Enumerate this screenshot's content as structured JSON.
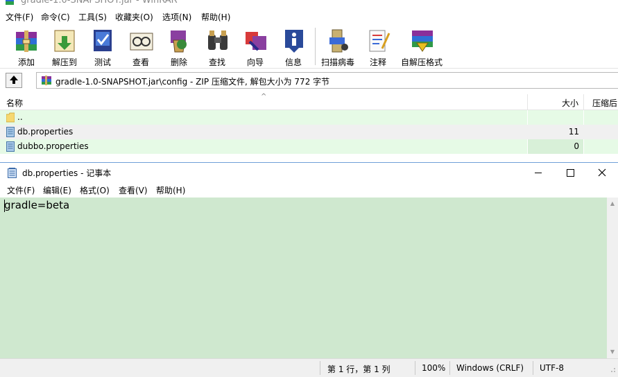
{
  "winrar": {
    "title": "gradle-1.0-SNAPSHOT.jar - WinRAR",
    "menu": [
      "文件(F)",
      "命令(C)",
      "工具(S)",
      "收藏夹(O)",
      "选项(N)",
      "帮助(H)"
    ],
    "toolbar": [
      {
        "label": "添加",
        "icon": "add-archive-icon"
      },
      {
        "label": "解压到",
        "icon": "extract-to-icon"
      },
      {
        "label": "测试",
        "icon": "test-icon"
      },
      {
        "label": "查看",
        "icon": "view-icon"
      },
      {
        "label": "删除",
        "icon": "delete-icon"
      },
      {
        "label": "查找",
        "icon": "find-icon"
      },
      {
        "label": "向导",
        "icon": "wizard-icon"
      },
      {
        "label": "信息",
        "icon": "info-icon"
      },
      {
        "label": "扫描病毒",
        "icon": "virus-scan-icon"
      },
      {
        "label": "注释",
        "icon": "comment-icon"
      },
      {
        "label": "自解压格式",
        "icon": "sfx-icon"
      }
    ],
    "path": "gradle-1.0-SNAPSHOT.jar\\config - ZIP 压缩文件, 解包大小为 772 字节",
    "columns": {
      "name": "名称",
      "size": "大小",
      "packed": "压缩后"
    },
    "files": [
      {
        "name": "..",
        "size": "",
        "type": "folder"
      },
      {
        "name": "db.properties",
        "size": "11",
        "type": "file"
      },
      {
        "name": "dubbo.properties",
        "size": "0",
        "type": "file"
      }
    ]
  },
  "notepad": {
    "title": "db.properties - 记事本",
    "menu": [
      "文件(F)",
      "编辑(E)",
      "格式(O)",
      "查看(V)",
      "帮助(H)"
    ],
    "content": "gradle=beta",
    "status": {
      "position": "第 1 行，第 1 列",
      "zoom": "100%",
      "line_ending": "Windows (CRLF)",
      "encoding": "UTF-8"
    }
  },
  "colors": {
    "editor_bg": "#cfe8cf",
    "row_highlight": "#e6fae6",
    "row_selected": "#f0f0f0"
  }
}
